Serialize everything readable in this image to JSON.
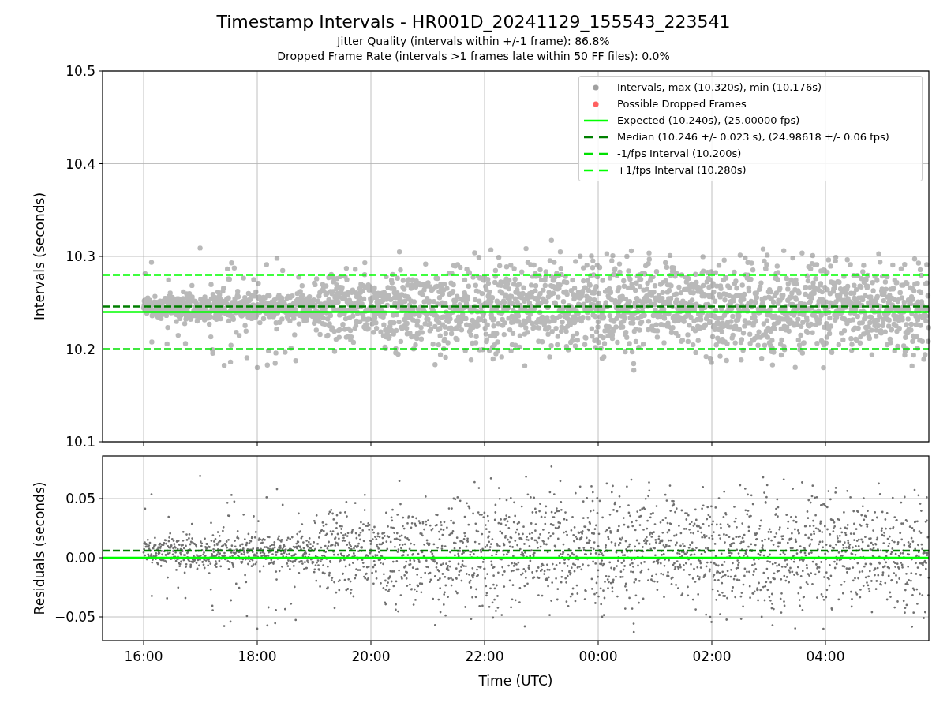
{
  "figure": {
    "title": "Timestamp Intervals - HR001D_20241129_155543_223541",
    "subtitles": [
      "Jitter Quality (intervals within +/-1 frame): 86.8%",
      "Dropped Frame Rate (intervals >1 frames late within 50 FF files): 0.0%"
    ]
  },
  "intervals_panel": {
    "y_axis_label": "Intervals (seconds)",
    "y_tick_labels": [
      "10.5",
      "10.4",
      "10.3",
      "10.2",
      "10.1"
    ],
    "legend": [
      {
        "kind": "dot",
        "color": "#a0a0a0",
        "label": "Intervals, max (10.320s), min (10.176s)"
      },
      {
        "kind": "dot",
        "color": "#ff6060",
        "label": "Possible Dropped Frames"
      },
      {
        "kind": "line",
        "color": "#00ff00",
        "label": "Expected (10.240s), (25.00000 fps)"
      },
      {
        "kind": "dashed",
        "color": "#007f00",
        "label": "Median (10.246 +/- 0.023 s), (24.98618 +/- 0.06 fps)"
      },
      {
        "kind": "dashed",
        "color": "#00e000",
        "label": "-1/fps Interval (10.200s)"
      },
      {
        "kind": "dashed",
        "color": "#00ff00",
        "label": "+1/fps Interval (10.280s)"
      }
    ]
  },
  "residuals_panel": {
    "y_axis_label": "Residuals (seconds)",
    "x_axis_label": "Time (UTC)",
    "y_tick_labels": [
      "0.05",
      "0.00",
      "−0.05"
    ],
    "x_tick_labels": [
      "16:00",
      "18:00",
      "20:00",
      "22:00",
      "00:00",
      "02:00",
      "04:00"
    ]
  }
}
